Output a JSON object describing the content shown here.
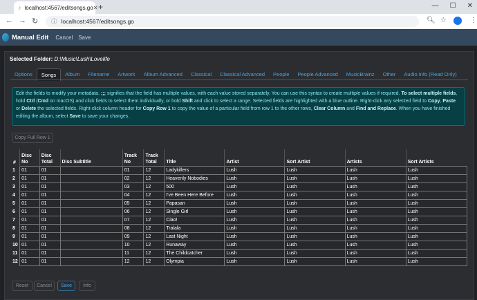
{
  "browser": {
    "tab_title": "localhost:4567/editsongs.go",
    "url": "localhost:4567/editsongs.go"
  },
  "app": {
    "title": "Manual Edit",
    "cancel_label": "Cancel",
    "save_label": "Save"
  },
  "folder": {
    "label": "Selected Folder:",
    "path": "D:\\Music\\Lush\\Lovelife"
  },
  "tabs": [
    "Options",
    "Songs",
    "Album",
    "Filename",
    "Artwork",
    "Album Advanced",
    "Classical",
    "Classical Advanced",
    "People",
    "People Advanced",
    "MusicBrainz",
    "Other",
    "Audio Info (Read Only)"
  ],
  "active_tab": "Songs",
  "help": {
    "t1": "Edit the fields to modify your metadata. ",
    "t2": ";;;",
    "t3": " signifies that the field has multiple values, with each value stored separately. You can use this syntax to create multiple values if required. ",
    "t4": "To select multiple fields",
    "t5": ", hold ",
    "t6": "Ctrl",
    "t7": " (",
    "t8": "Cmd",
    "t9": " on macOS) and click fields to select them individually, or hold ",
    "t10": "Shift",
    "t11": " and click to select a range. Selected fields are highlighted with a blue outline. Right-click any selected field to ",
    "t12": "Copy",
    "t13": ", ",
    "t14": "Paste",
    "t15": " or ",
    "t16": "Delete",
    "t17": " the selected fields. Right-click column header for ",
    "t18": "Copy Row 1",
    "t19": " to copy the value of a particular field from row 1 to the other rows, ",
    "t20": "Clear Column",
    "t21": " and ",
    "t22": "Find and Replace",
    "t23": ". When you have finished editing the album, select ",
    "t24": "Save",
    "t25": " to save your changes."
  },
  "copy_full_row_label": "Copy Full Row 1",
  "table": {
    "headers": {
      "num": "#",
      "disc_no_1": "Disc",
      "disc_no_2": "No",
      "disc_total_1": "Disc",
      "disc_total_2": "Total",
      "disc_subtitle": "Disc Subtitle",
      "track_no_1": "Track",
      "track_no_2": "No",
      "track_total_1": "Track",
      "track_total_2": "Total",
      "title": "Title",
      "artist": "Artist",
      "sort_artist": "Sort Artist",
      "artists": "Artists",
      "sort_artists": "Sort Artists"
    },
    "rows": [
      {
        "n": "1",
        "disc_no": "01",
        "disc_total": "01",
        "disc_subtitle": "",
        "track_no": "01",
        "track_total": "12",
        "title": "Ladykillers",
        "artist": "Lush",
        "sort_artist": "Lush",
        "artists": "Lush",
        "sort_artists": "Lush"
      },
      {
        "n": "2",
        "disc_no": "01",
        "disc_total": "01",
        "disc_subtitle": "",
        "track_no": "02",
        "track_total": "12",
        "title": "Heavenly Nobodies",
        "artist": "Lush",
        "sort_artist": "Lush",
        "artists": "Lush",
        "sort_artists": "Lush"
      },
      {
        "n": "3",
        "disc_no": "01",
        "disc_total": "01",
        "disc_subtitle": "",
        "track_no": "03",
        "track_total": "12",
        "title": "500",
        "artist": "Lush",
        "sort_artist": "Lush",
        "artists": "Lush",
        "sort_artists": "Lush"
      },
      {
        "n": "4",
        "disc_no": "01",
        "disc_total": "01",
        "disc_subtitle": "",
        "track_no": "04",
        "track_total": "12",
        "title": "I've Been Here Before",
        "artist": "Lush",
        "sort_artist": "Lush",
        "artists": "Lush",
        "sort_artists": "Lush"
      },
      {
        "n": "5",
        "disc_no": "01",
        "disc_total": "01",
        "disc_subtitle": "",
        "track_no": "05",
        "track_total": "12",
        "title": "Papasan",
        "artist": "Lush",
        "sort_artist": "Lush",
        "artists": "Lush",
        "sort_artists": "Lush"
      },
      {
        "n": "6",
        "disc_no": "01",
        "disc_total": "01",
        "disc_subtitle": "",
        "track_no": "06",
        "track_total": "12",
        "title": "Single Girl",
        "artist": "Lush",
        "sort_artist": "Lush",
        "artists": "Lush",
        "sort_artists": "Lush"
      },
      {
        "n": "7",
        "disc_no": "01",
        "disc_total": "01",
        "disc_subtitle": "",
        "track_no": "07",
        "track_total": "12",
        "title": "Ciao!",
        "artist": "Lush",
        "sort_artist": "Lush",
        "artists": "Lush",
        "sort_artists": "Lush"
      },
      {
        "n": "8",
        "disc_no": "01",
        "disc_total": "01",
        "disc_subtitle": "",
        "track_no": "08",
        "track_total": "12",
        "title": "Tralala",
        "artist": "Lush",
        "sort_artist": "Lush",
        "artists": "Lush",
        "sort_artists": "Lush"
      },
      {
        "n": "9",
        "disc_no": "01",
        "disc_total": "01",
        "disc_subtitle": "",
        "track_no": "09",
        "track_total": "12",
        "title": "Last Night",
        "artist": "Lush",
        "sort_artist": "Lush",
        "artists": "Lush",
        "sort_artists": "Lush"
      },
      {
        "n": "10",
        "disc_no": "01",
        "disc_total": "01",
        "disc_subtitle": "",
        "track_no": "10",
        "track_total": "12",
        "title": "Runaway",
        "artist": "Lush",
        "sort_artist": "Lush",
        "artists": "Lush",
        "sort_artists": "Lush"
      },
      {
        "n": "11",
        "disc_no": "01",
        "disc_total": "01",
        "disc_subtitle": "",
        "track_no": "11",
        "track_total": "12",
        "title": "The Childcatcher",
        "artist": "Lush",
        "sort_artist": "Lush",
        "artists": "Lush",
        "sort_artists": "Lush"
      },
      {
        "n": "12",
        "disc_no": "01",
        "disc_total": "01",
        "disc_subtitle": "",
        "track_no": "12",
        "track_total": "12",
        "title": "Olympia",
        "artist": "Lush",
        "sort_artist": "Lush",
        "artists": "Lush",
        "sort_artists": "Lush"
      }
    ]
  },
  "footer": {
    "reset": "Reset",
    "cancel": "Cancel",
    "save": "Save",
    "info": "Info"
  },
  "colors": {
    "accent": "#4aa3df",
    "app_bar": "#34495e",
    "alert_bg": "#073f45",
    "alert_text": "#8fe6ef"
  }
}
